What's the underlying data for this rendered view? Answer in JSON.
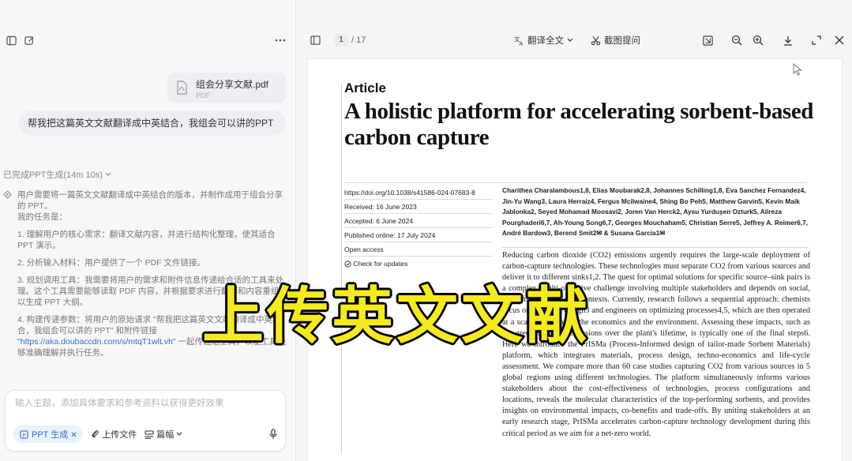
{
  "chat": {
    "attachment": {
      "name": "组会分享文献.pdf",
      "type": "PDF"
    },
    "user_message": "帮我把这篇英文文献翻译成中英结合，我组会可以讲的PPT",
    "thinking_status": "已完成PPT生成(14m 10s)",
    "thinking": {
      "intro": "用户需要将一篇英文文献翻译成中英结合的版本，并制作成用于组会分享的 PPT。",
      "tasks_label": "我的任务是：",
      "items": [
        "1. 理解用户的核心需求：翻译文献内容，并进行结构化整理，使其适合 PPT 演示。",
        "2. 分析输入材料：用户提供了一个 PDF 文件链接。",
        "3. 规划调用工具：我需要将用户的需求和附件信息传递给合适的工具来处理。这个工具需要能够读取 PDF 内容，并根据要求进行翻译和内容重组，以生成 PPT 大纲。",
        "4. 构建传递参数：将用户的原始请求 \"帮我把这篇英文文献翻译成中英结合，我组会可以讲的 PPT\" 和附件链接"
      ],
      "link": "\"https://aka.doubaccdn.com/s/mtqT1wlLvh\"",
      "link_suffix": " 一起传递给工具，以便工具能够准确理解并执行任务。"
    },
    "composer": {
      "placeholder": "输入主题，添加具体要求和参考资料以获得更好效果",
      "chip": "PPT 生成",
      "upload": "上传文件",
      "length": "篇幅"
    }
  },
  "viewer": {
    "page_current": "1",
    "page_total": "/ 17",
    "translate": "翻译全文",
    "screenshot_ask": "截图提问"
  },
  "article": {
    "label": "Article",
    "title": "A holistic platform for accelerating sorbent-based carbon capture",
    "meta": [
      "https://doi.org/10.1038/s41586-024-07683-8",
      "Received: 16 June 2023",
      "Accepted: 6 June 2024",
      "Published online: 17 July 2024",
      "Open access",
      "Check for updates"
    ],
    "authors": "Charithea Charalambous1,8, Elias Moubarak2,8, Johannes Schilling1,8, Eva Sanchez Fernandez4, Jin-Yu Wang3, Laura Herraiz4, Fergus Mcilwaine4, Shing Bo Peh5, Matthew Garvin5, Kevin Maik Jablonka2, Seyed Mohamad Moosavi2, Joren Van Herck2, Aysu Yurduşen Ozturk5, Alireza Pourghaderi6,7, Ah-Young Song6,7, Georges Mouchaham5, Christian Serre5, Jeffrey A. Reimer6,7, André Bardow3, Berend Smit2✉ & Susana Garcia1✉",
    "abstract": "Reducing carbon dioxide (CO2) emissions urgently requires the large-scale deployment of carbon-capture technologies. These technologies must separate CO2 from various sources and deliver it to different sinks1,2. The quest for optimal solutions for specific source–sink pairs is a complex, multi-objective challenge involving multiple stakeholders and depends on social, economic and regional contexts. Currently, research follows a sequential approach: chemists focus on materials design3 and engineers on optimizing processes4,5, which are then operated at a scale that impacts the economics and the environment. Assessing these impacts, such as the greenhouse gas emissions over the plant's lifetime, is typically one of the final steps6. Here we introduce the PrISMa (Process-Informed design of tailor-made Sorbent Materials) platform, which integrates materials, process design, techno-economics and life-cycle assessment. We compare more than 60 case studies capturing CO2 from various sources in 5 global regions using different technologies. The platform simultaneously informs various stakeholders about the cost-effectiveness of technologies, process configurations and locations, reveals the molecular characteristics of the top-performing sorbents, and provides insights on environmental impacts, co-benefits and trade-offs. By uniting stakeholders at an early research stage, PrISMa accelerates carbon-capture technology development during this critical period as we aim for a net-zero world."
  },
  "overlay": {
    "caption": "上传英文文献",
    "color": "#f5ea1c"
  }
}
